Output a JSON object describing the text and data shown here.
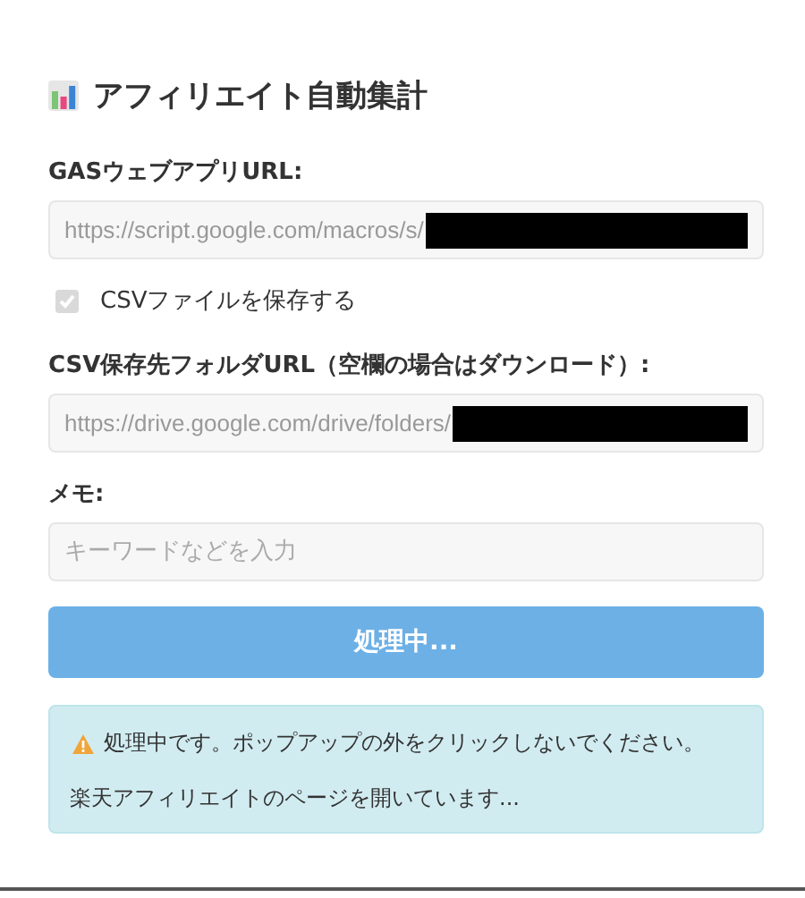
{
  "title": "アフィリエイト自動集計",
  "fields": [
    {
      "kind": "text",
      "label": "GASウェブアプリURL:",
      "value": "https://script.google.com/macros/s/",
      "redacted": true,
      "disabled": true
    },
    {
      "kind": "checkbox",
      "label": "CSVファイルを保存する",
      "checked": true,
      "disabled": true
    },
    {
      "kind": "text",
      "label": "CSV保存先フォルダURL（空欄の場合はダウンロード）:",
      "value": "https://drive.google.com/drive/folders/",
      "redacted": true,
      "disabled": true
    },
    {
      "kind": "text",
      "label": "メモ:",
      "placeholder": "キーワードなどを入力",
      "disabled": true
    }
  ],
  "submit_button": {
    "label": "処理中...",
    "disabled": true
  },
  "alert": {
    "messages": [
      "処理中です。ポップアップの外をクリックしないでください。",
      "楽天アフィリエイトのページを開いています..."
    ]
  }
}
